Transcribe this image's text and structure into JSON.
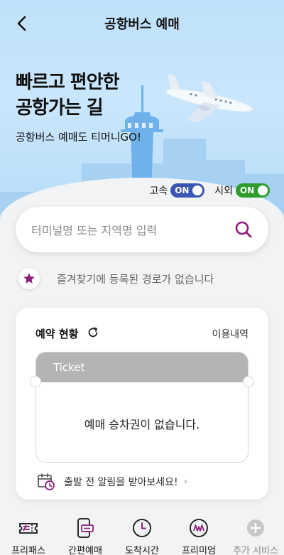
{
  "header": {
    "title": "공항버스 예매"
  },
  "hero": {
    "headline_line1": "빠르고 편안한",
    "headline_line2": "공항가는 길",
    "subline": "공항버스 예매도 티머니GO!"
  },
  "toggles": [
    {
      "label": "고속",
      "state": "ON",
      "color": "#3a55b4"
    },
    {
      "label": "시외",
      "state": "ON",
      "color": "#2e9d2e"
    }
  ],
  "search": {
    "placeholder": "터미널명 또는 지역명 입력"
  },
  "favorites": {
    "empty_text": "즐겨찾기에 등록된 경로가 없습니다"
  },
  "reservation": {
    "title": "예약 현황",
    "history_link": "이용내역",
    "ticket_header": "Ticket",
    "empty_text": "예매 승차권이 없습니다.",
    "alarm_text": "출발 전 알림을 받아보세요!"
  },
  "bottom_nav": [
    {
      "label": "프리패스",
      "icon": "ticket-pass-icon"
    },
    {
      "label": "간편예매",
      "icon": "phone-ticket-icon"
    },
    {
      "label": "도착시간",
      "icon": "clock-icon"
    },
    {
      "label": "프리미엄",
      "icon": "premium-icon"
    },
    {
      "label": "추가 서비스",
      "icon": "plus-circle-icon"
    }
  ],
  "colors": {
    "accent": "#8e1c7a",
    "hero_bg": "#c0e2fb"
  }
}
